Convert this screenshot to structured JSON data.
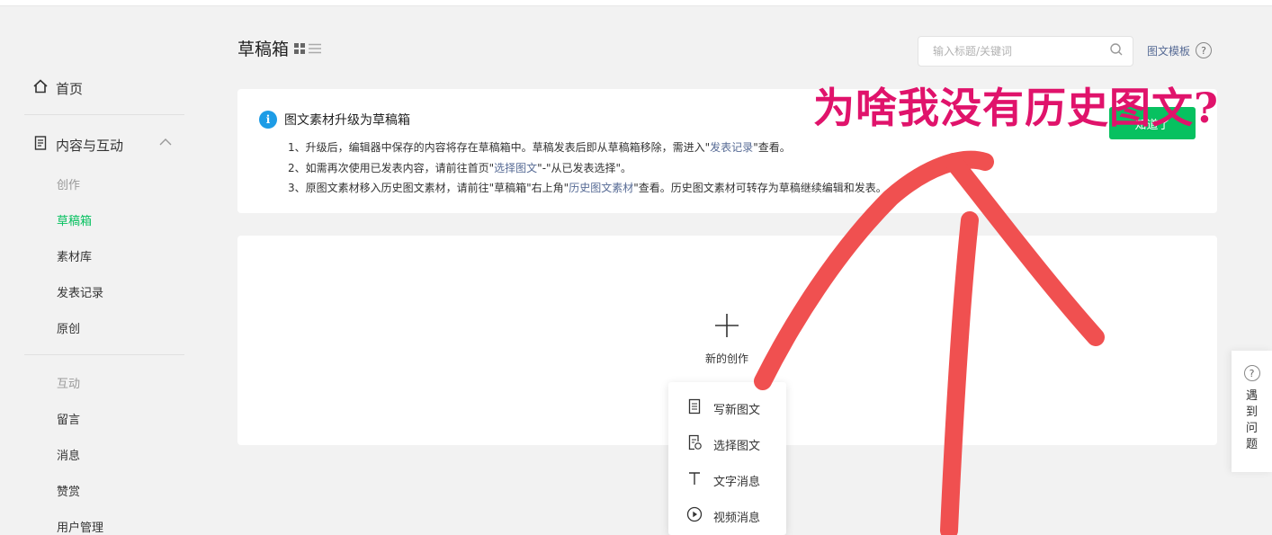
{
  "sidebar": {
    "home": "首页",
    "section": "内容与互动",
    "create_group": "创作",
    "create_items": [
      "草稿箱",
      "素材库",
      "发表记录",
      "原创"
    ],
    "interact_group": "互动",
    "interact_items": [
      "留言",
      "消息",
      "赞赏",
      "用户管理"
    ]
  },
  "header": {
    "title": "草稿箱",
    "search_placeholder": "输入标题/关键词",
    "template_link": "图文模板"
  },
  "notice": {
    "title": "图文素材升级为草稿箱",
    "line1_a": "1、升级后，编辑器中保存的内容将存在草稿箱中。草稿发表后即从草稿箱移除，需进入\"",
    "line1_link": "发表记录",
    "line1_b": "\"查看。",
    "line2_a": "2、如需再次使用已发表内容，请前往首页\"",
    "line2_link": "选择图文",
    "line2_b": "\"-\"从已发表选择\"。",
    "line3_a": "3、原图文素材移入历史图文素材，请前往\"草稿箱\"右上角\"",
    "line3_link": "历史图文素材",
    "line3_b": "\"查看。历史图文素材可转存为草稿继续编辑和发表。",
    "button": "知道了"
  },
  "main": {
    "new_create": "新的创作"
  },
  "menu": {
    "items": [
      "写新图文",
      "选择图文",
      "文字消息",
      "视频消息"
    ]
  },
  "help": {
    "label": "遇到问题"
  },
  "annotation": {
    "text": "为啥我没有历史图文?",
    "color": "#e0136b",
    "stroke_color": "#f05050"
  }
}
